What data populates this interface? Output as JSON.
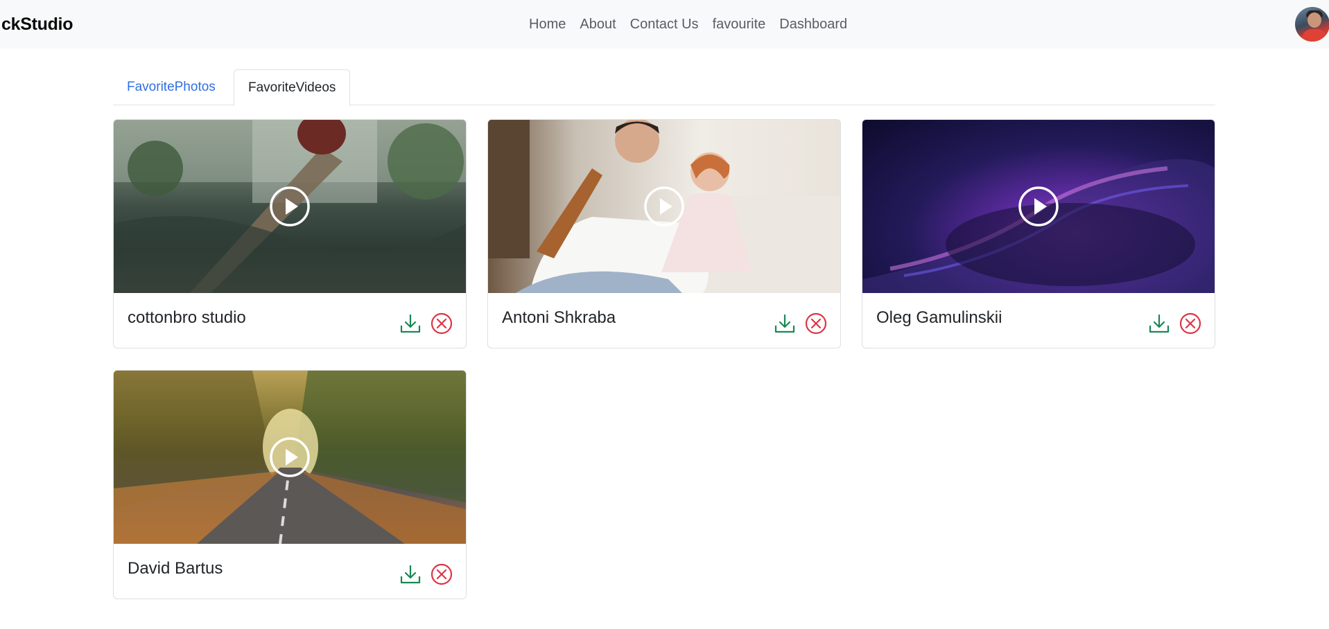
{
  "navbar": {
    "brand": "ckStudio",
    "links": [
      "Home",
      "About",
      "Contact Us",
      "favourite",
      "Dashboard"
    ]
  },
  "tabs": {
    "photos": "FavoritePhotos",
    "videos": "FavoriteVideos",
    "active": "FavoriteVideos"
  },
  "cards": [
    {
      "author": "cottonbro studio"
    },
    {
      "author": "Antoni Shkraba"
    },
    {
      "author": "Oleg Gamulinskii"
    },
    {
      "author": "David Bartus"
    }
  ],
  "icons": {
    "download": "download-icon",
    "remove": "close-circle-icon",
    "play": "play-icon"
  },
  "colors": {
    "download": "#198754",
    "remove": "#dc3545",
    "active_link": "#2f6fe3",
    "navbar_bg": "#f8f9fa"
  }
}
